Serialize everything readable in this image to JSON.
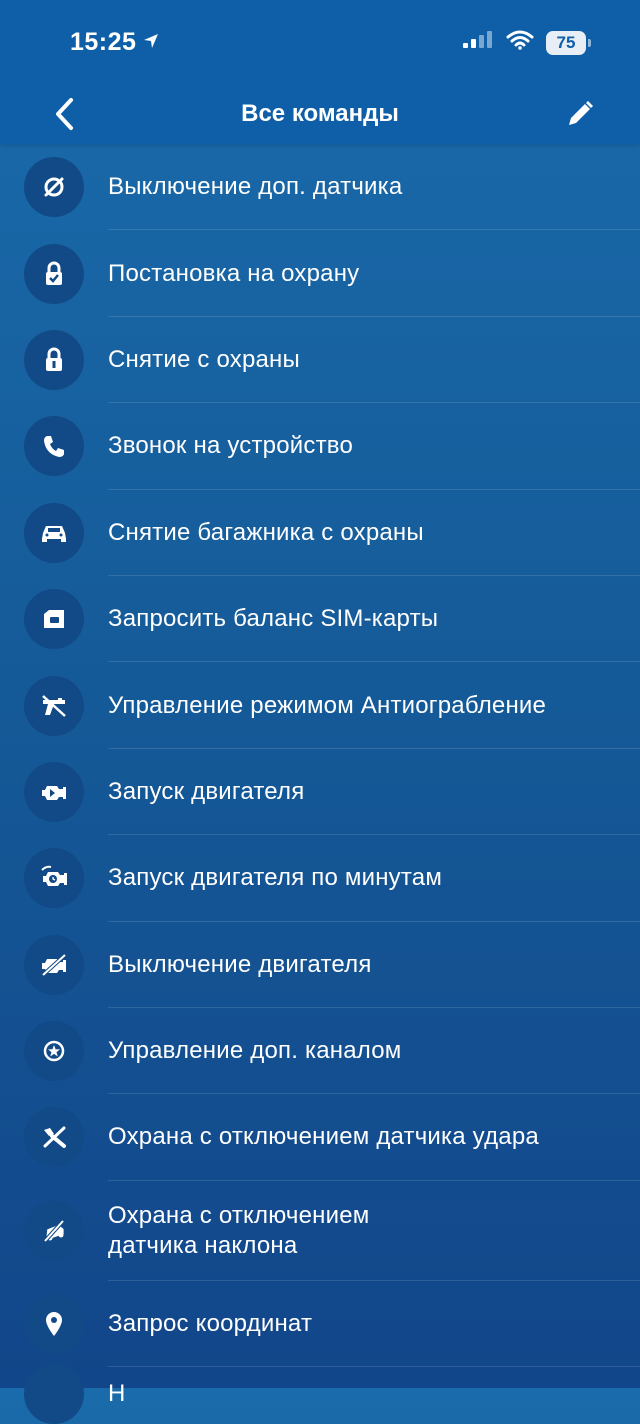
{
  "status_bar": {
    "time": "15:25",
    "battery": "75"
  },
  "nav": {
    "title": "Все команды"
  },
  "commands": [
    {
      "label": "Выключение доп. датчика",
      "icon": "sensor-off-icon"
    },
    {
      "label": "Постановка на охрану",
      "icon": "lock-arm-icon"
    },
    {
      "label": "Снятие с охраны",
      "icon": "lock-disarm-icon"
    },
    {
      "label": "Звонок на устройство",
      "icon": "phone-icon"
    },
    {
      "label": "Снятие багажника с охраны",
      "icon": "car-trunk-icon"
    },
    {
      "label": "Запросить баланс SIM-карты",
      "icon": "sim-card-icon"
    },
    {
      "label": "Управление режимом Антиограбление",
      "icon": "anti-robbery-icon"
    },
    {
      "label": "Запуск двигателя",
      "icon": "engine-start-icon"
    },
    {
      "label": "Запуск двигателя по минутам",
      "icon": "engine-timer-icon"
    },
    {
      "label": "Выключение двигателя",
      "icon": "engine-stop-icon"
    },
    {
      "label": "Управление доп. каналом",
      "icon": "extra-channel-icon"
    },
    {
      "label": "Охрана с отключением датчика удара",
      "icon": "shock-sensor-off-icon"
    },
    {
      "label": "Охрана с отключением\nдатчика наклона",
      "icon": "tilt-sensor-off-icon"
    },
    {
      "label": "Запрос координат",
      "icon": "location-pin-icon"
    }
  ],
  "partial_row_label": "Н"
}
